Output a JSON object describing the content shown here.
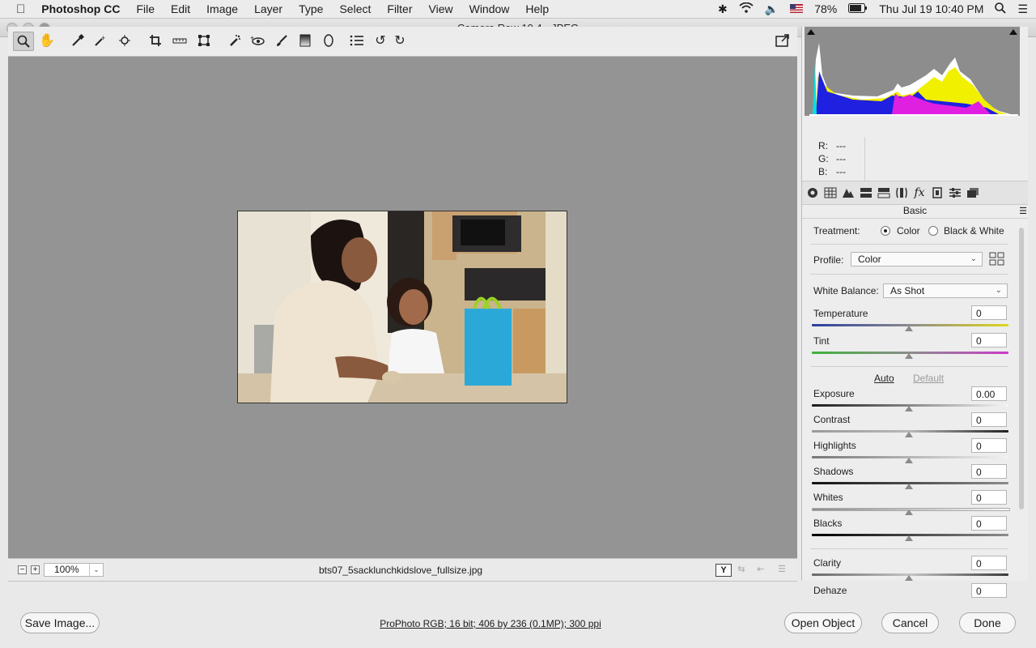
{
  "menubar": {
    "app": "Photoshop CC",
    "items": [
      "File",
      "Edit",
      "Image",
      "Layer",
      "Type",
      "Select",
      "Filter",
      "View",
      "Window",
      "Help"
    ],
    "battery": "78%",
    "clock": "Thu Jul 19  10:40 PM"
  },
  "window": {
    "title": "Camera Raw 10.4  -  JPEG"
  },
  "preview": {
    "zoom": "100%",
    "filename": "bts07_5sacklunchkidslove_fullsize.jpg"
  },
  "histogram": {
    "r_label": "R:",
    "g_label": "G:",
    "b_label": "B:",
    "r": "---",
    "g": "---",
    "b": "---"
  },
  "panel": {
    "title": "Basic",
    "treatment_label": "Treatment:",
    "treatment_color": "Color",
    "treatment_bw": "Black & White",
    "profile_label": "Profile:",
    "profile_value": "Color",
    "wb_label": "White Balance:",
    "wb_value": "As Shot",
    "temperature_label": "Temperature",
    "temperature": "0",
    "tint_label": "Tint",
    "tint": "0",
    "auto": "Auto",
    "default": "Default",
    "exposure_label": "Exposure",
    "exposure": "0.00",
    "contrast_label": "Contrast",
    "contrast": "0",
    "highlights_label": "Highlights",
    "highlights": "0",
    "shadows_label": "Shadows",
    "shadows": "0",
    "whites_label": "Whites",
    "whites": "0",
    "blacks_label": "Blacks",
    "blacks": "0",
    "clarity_label": "Clarity",
    "clarity": "0",
    "dehaze_label": "Dehaze",
    "dehaze": "0"
  },
  "footer": {
    "save": "Save Image...",
    "info": "ProPhoto RGB; 16 bit; 406 by 236 (0.1MP); 300 ppi",
    "open": "Open Object",
    "cancel": "Cancel",
    "done": "Done"
  }
}
